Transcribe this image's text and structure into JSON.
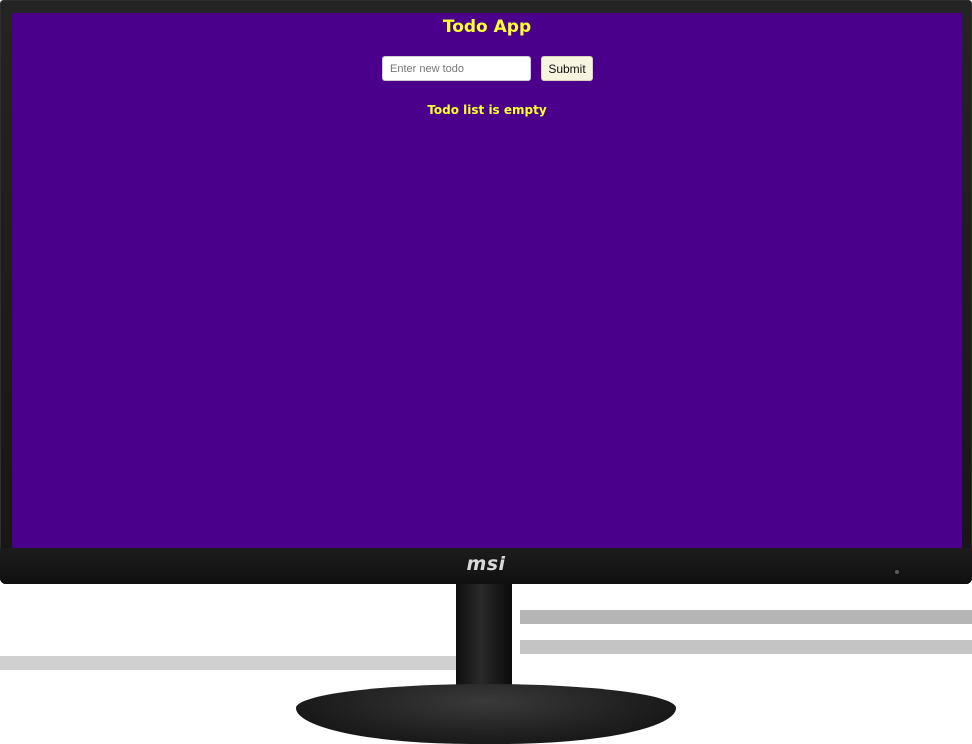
{
  "app": {
    "title": "Todo App",
    "background_color": "#4b008c",
    "accent_color": "#ffff33"
  },
  "form": {
    "input_value": "",
    "input_placeholder": "Enter new todo",
    "submit_label": "Submit"
  },
  "todo_list": {
    "items": [],
    "empty_message": "Todo list is empty"
  },
  "monitor": {
    "brand": "msi"
  }
}
